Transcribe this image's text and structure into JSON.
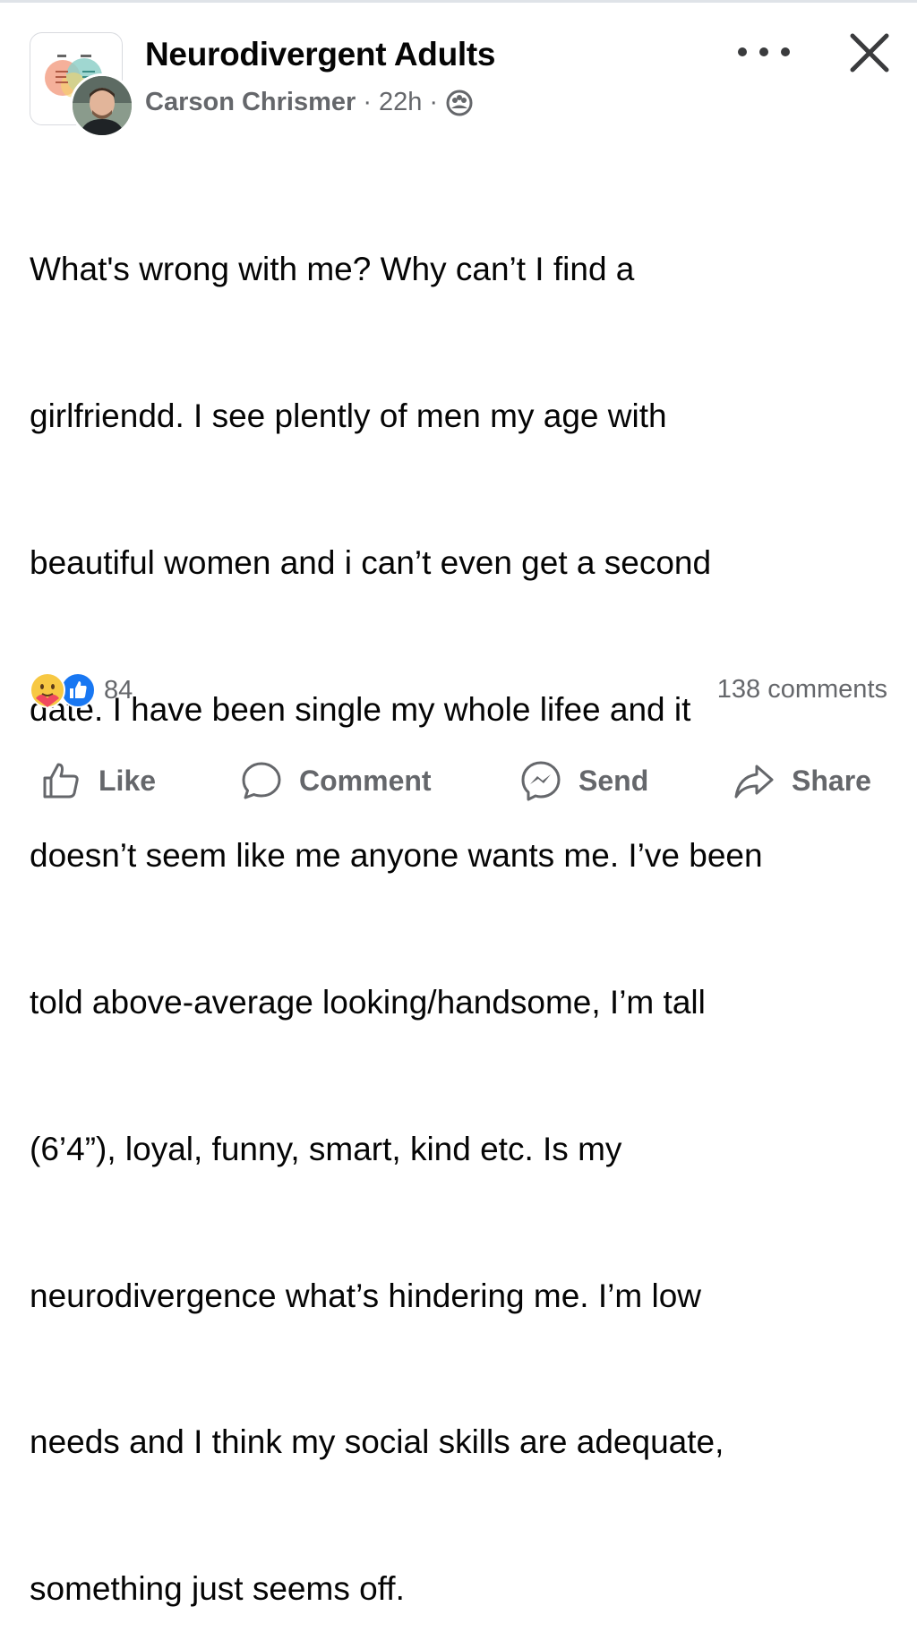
{
  "post": {
    "group_name": "Neurodivergent Adults",
    "author": "Carson Chrismer",
    "separator": "·",
    "time": "22h",
    "privacy_icon": "group-members-icon",
    "lines": [
      "What's wrong with me? Why can’t I find a",
      "girlfriendd. I see plently of men my age with",
      "beautiful women and i can’t even get a second",
      "date. I have been single my whole lifee and it",
      "doesn’t seem like me anyone wants me. I’ve been",
      "told above-average looking/handsome, I’m tall",
      "(6’4”), loyal, funny, smart, kind etc. Is my",
      "neurodivergence what’s hindering me. I’m low",
      "needs and I think my social skills are adequate,",
      "something just seems off."
    ]
  },
  "engagement": {
    "reaction_icons": [
      "care-reaction-icon",
      "like-reaction-icon"
    ],
    "reaction_count": "84",
    "comments": "138 comments"
  },
  "actions": {
    "like": "Like",
    "comment": "Comment",
    "send": "Send",
    "share": "Share"
  },
  "colors": {
    "text": "#050505",
    "secondary": "#65676b",
    "like_blue": "#1877f2"
  }
}
